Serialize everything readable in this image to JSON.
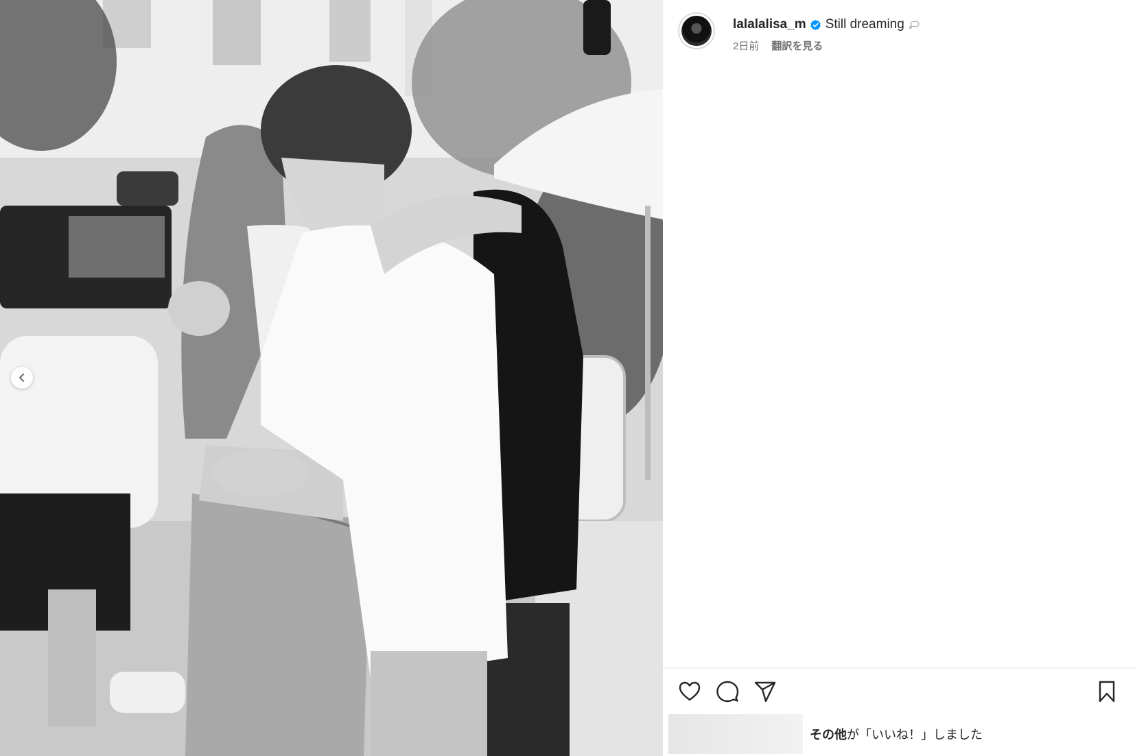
{
  "post": {
    "username": "lalalalisa_m",
    "caption": "Still dreaming",
    "posted_ago": "2日前",
    "translate_label": "翻訳を見る"
  },
  "actions": {
    "like_icon": "heart-icon",
    "comment_icon": "comment-icon",
    "share_icon": "paper-plane-icon",
    "save_icon": "bookmark-icon"
  },
  "likes": {
    "bold_text": "その他",
    "rest_text": "が「いいね！」しました"
  },
  "carousel": {
    "prev_icon": "chevron-left-icon"
  },
  "colors": {
    "verified_badge": "#0095f6",
    "text_primary": "#262626",
    "text_secondary": "#737373",
    "divider": "#dbdbdb"
  }
}
